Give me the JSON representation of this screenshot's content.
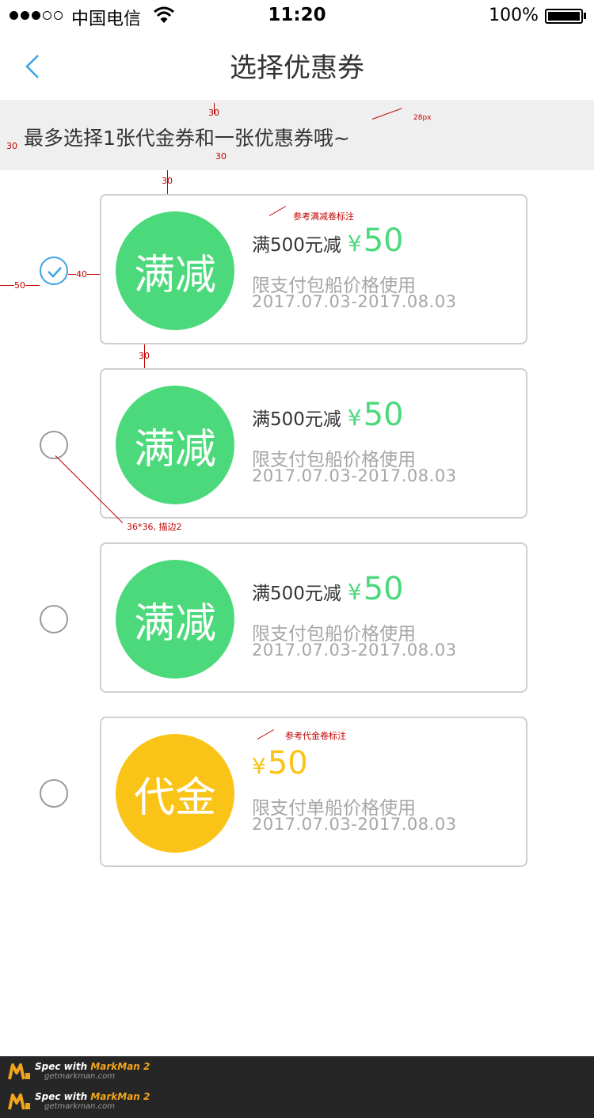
{
  "status_bar": {
    "carrier": "中国电信",
    "time": "11:20",
    "battery": "100%"
  },
  "nav": {
    "title": "选择优惠券"
  },
  "notice": {
    "text": "最多选择1张代金券和一张优惠券哦~"
  },
  "coupons": [
    {
      "badge": "满减",
      "condition": "满500元减",
      "currency": "¥",
      "amount": "50",
      "restriction": "限支付包船价格使用",
      "period": "2017.07.03-2017.08.03",
      "checked": true
    },
    {
      "badge": "满减",
      "condition": "满500元减",
      "currency": "¥",
      "amount": "50",
      "restriction": "限支付包船价格使用",
      "period": "2017.07.03-2017.08.03",
      "checked": false
    },
    {
      "badge": "满减",
      "condition": "满500元减",
      "currency": "¥",
      "amount": "50",
      "restriction": "限支付包船价格使用",
      "period": "2017.07.03-2017.08.03",
      "checked": false
    },
    {
      "badge": "代金",
      "condition": "",
      "currency": "¥",
      "amount": "50",
      "restriction": "限支付单船价格使用",
      "period": "2017.07.03-2017.08.03",
      "checked": false
    }
  ],
  "annotations": {
    "font_size": "28px",
    "gap_30": "30",
    "gap_40": "40",
    "gap_50": "50",
    "discount_ref": "参考满减卷标注",
    "radio_spec": "36*36, 描边2",
    "voucher_ref": "参考代金卷标注"
  },
  "watermark": {
    "prefix": "Spec with ",
    "brand": "MarkMan 2",
    "url": "getmarkman.com"
  },
  "colors": {
    "discount_green": "#4cd97b",
    "voucher_yellow": "#f9c417",
    "check_blue": "#3aa3e3",
    "annotation_red": "#c00000"
  }
}
